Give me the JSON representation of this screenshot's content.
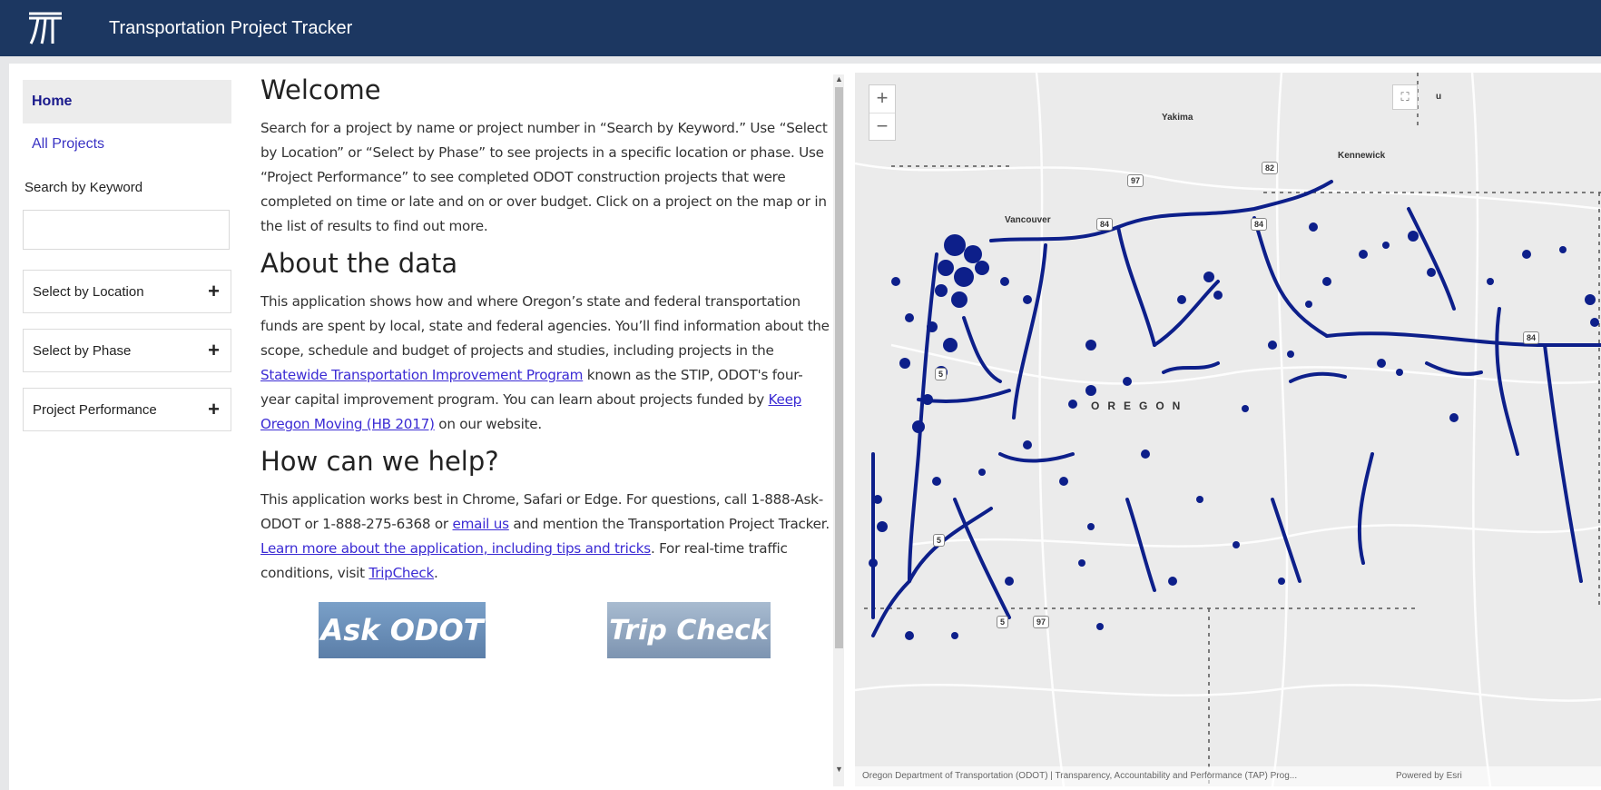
{
  "header": {
    "title": "Transportation Project Tracker",
    "logo_icon": "odot-logo-icon"
  },
  "sidebar": {
    "home": "Home",
    "all_projects": "All Projects",
    "search_label": "Search by Keyword",
    "search_value": "",
    "accordions": [
      {
        "label": "Select by Location",
        "icon": "+"
      },
      {
        "label": "Select by Phase",
        "icon": "+"
      },
      {
        "label": "Project Performance",
        "icon": "+"
      }
    ]
  },
  "content": {
    "welcome_title": "Welcome",
    "welcome_text": "Search for a project by name or project number in “Search by Keyword.” Use “Select by Location” or “Select by Phase” to see projects in a specific location or phase. Use “Project Performance” to see completed ODOT construction projects that were completed on time or late and on or over budget. Click on a project on the map or in the list of results to find out more.",
    "about_title": "About the data",
    "about_text_1": "This application shows how and where Oregon’s state and federal transportation funds are spent by local, state and federal agencies. You’ll find information about the scope, schedule and budget of projects and studies, including projects in the ",
    "about_link_stip": "Statewide Transportation Improvement Program",
    "about_text_2": " known as the STIP, ODOT's four-year capital improvement program. You can learn about projects funded by ",
    "about_link_kom": "Keep Oregon Moving (HB 2017)",
    "about_text_3": " on our website.",
    "help_title": "How can we help?",
    "help_text_1": "This application works best in Chrome, Safari or Edge. For questions, call 1-888-Ask-ODOT or 1-888-275-6368 or ",
    "help_link_email": "email us",
    "help_text_2": " and mention the Transportation Project Tracker. ",
    "help_link_learn": "Learn more about the application, including tips and tricks",
    "help_text_3": ". For real-time traffic conditions, visit ",
    "help_link_tripcheck": "TripCheck",
    "help_text_4": ".",
    "badge_ask": "Ask ODOT",
    "badge_trip": "Trip Check"
  },
  "map": {
    "zoom_in": "+",
    "zoom_out": "−",
    "fullscreen_icon": "fullscreen-icon",
    "labels": {
      "yakima": "Yakima",
      "kennewick": "Kennewick",
      "vancouver": "Vancouver",
      "state": "OREGON",
      "cut_off": "u"
    },
    "shields": {
      "i82": "82",
      "us97_top": "97",
      "i84_a": "84",
      "i84_b": "84",
      "i84_c": "84",
      "i5_a": "5",
      "i5_b": "5",
      "i5_c": "5",
      "us97_bottom": "97"
    },
    "attribution_left": "Oregon Department of Transportation (ODOT) | Transparency, Accountability and Performance (TAP) Prog...",
    "attribution_right": "Powered by Esri",
    "project_color": "#0d1f8a"
  }
}
